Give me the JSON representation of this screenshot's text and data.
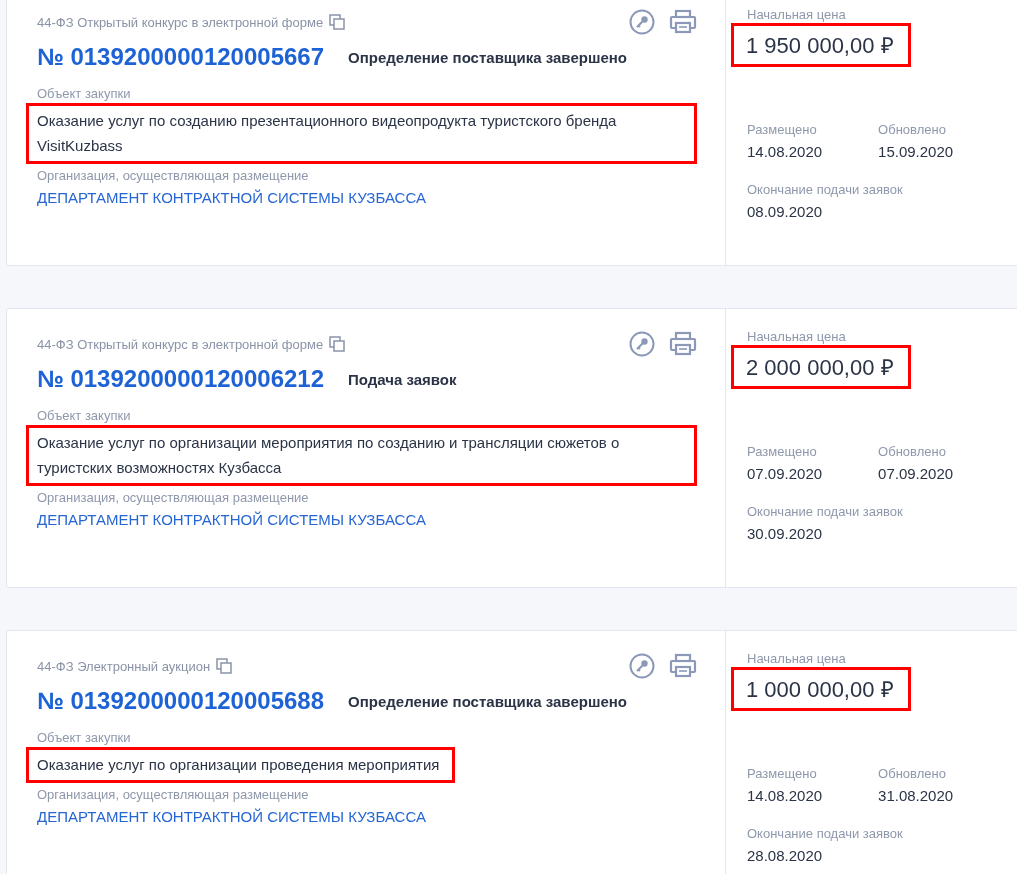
{
  "cards": [
    {
      "law_type": "44-ФЗ Открытый конкурс в электронной форме",
      "number": "№ 0139200000120005667",
      "status": "Определение поставщика завершено",
      "object_label": "Объект закупки",
      "object": "Оказание услуг по созданию презентационного видеопродукта туристского бренда VisitKuzbass",
      "object_marked": true,
      "org_label": "Организация, осуществляющая размещение",
      "org": "ДЕПАРТАМЕНТ КОНТРАКТНОЙ СИСТЕМЫ КУЗБАССА",
      "price_label": "Начальная цена",
      "price": "1 950 000,00 ₽",
      "price_marked": true,
      "posted_label": "Размещено",
      "posted": "14.08.2020",
      "updated_label": "Обновлено",
      "updated": "15.09.2020",
      "deadline_label": "Окончание подачи заявок",
      "deadline": "08.09.2020"
    },
    {
      "law_type": "44-ФЗ Открытый конкурс в электронной форме",
      "number": "№ 0139200000120006212",
      "status": "Подача заявок",
      "object_label": "Объект закупки",
      "object": "Оказание услуг по организации мероприятия по созданию и трансляции сюжетов о туристских возможностях Кузбасса",
      "object_marked": true,
      "org_label": "Организация, осуществляющая размещение",
      "org": "ДЕПАРТАМЕНТ КОНТРАКТНОЙ СИСТЕМЫ КУЗБАССА",
      "price_label": "Начальная цена",
      "price": "2 000 000,00 ₽",
      "price_marked": true,
      "posted_label": "Размещено",
      "posted": "07.09.2020",
      "updated_label": "Обновлено",
      "updated": "07.09.2020",
      "deadline_label": "Окончание подачи заявок",
      "deadline": "30.09.2020"
    },
    {
      "law_type": "44-ФЗ Электронный аукцион",
      "number": "№ 0139200000120005688",
      "status": "Определение поставщика завершено",
      "object_label": "Объект закупки",
      "object": "Оказание услуг по организации проведения мероприятия",
      "object_marked": true,
      "org_label": "Организация, осуществляющая размещение",
      "org": "ДЕПАРТАМЕНТ КОНТРАКТНОЙ СИСТЕМЫ КУЗБАССА",
      "price_label": "Начальная цена",
      "price": "1 000 000,00 ₽",
      "price_marked": true,
      "posted_label": "Размещено",
      "posted": "14.08.2020",
      "updated_label": "Обновлено",
      "updated": "31.08.2020",
      "deadline_label": "Окончание подачи заявок",
      "deadline": "28.08.2020"
    }
  ]
}
